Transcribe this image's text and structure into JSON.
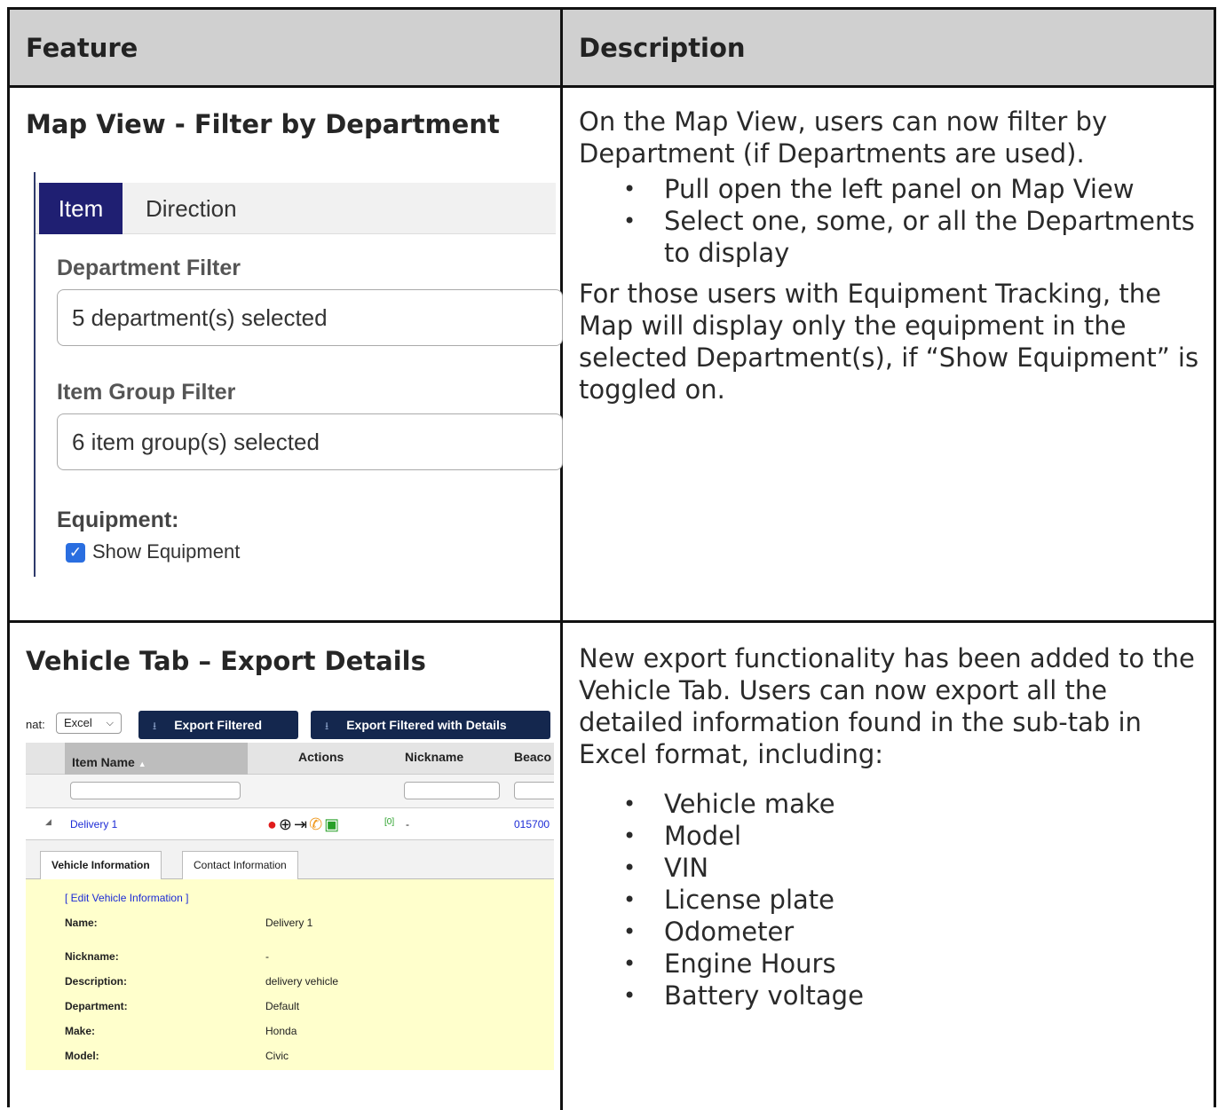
{
  "table": {
    "headers": {
      "feature": "Feature",
      "description": "Description"
    }
  },
  "row1": {
    "title": "Map View - Filter by Department",
    "para1": "On the Map View, users can now filter by Department (if Departments are used).",
    "bullets": [
      "Pull open the left panel on Map View",
      "Select one, some, or all the Departments to display"
    ],
    "para2": "For those users with Equipment Tracking, the Map will display only the equipment in the selected Department(s), if “Show Equipment” is toggled on.",
    "shot": {
      "tab_item": "Item",
      "tab_direction": "Direction",
      "dept_label": "Department Filter",
      "dept_value": "5 department(s) selected",
      "group_label": "Item Group Filter",
      "group_value": "6 item group(s) selected",
      "equipment_label": "Equipment:",
      "show_equipment": "Show Equipment"
    }
  },
  "row2": {
    "title": "Vehicle Tab – Export Details",
    "para1": "New export functionality has been added to the Vehicle Tab. Users can now export all the detailed information found in the sub-tab in Excel format, including:",
    "bullets": [
      "Vehicle make",
      "Model",
      "VIN",
      "License plate",
      "Odometer",
      "Engine Hours",
      "Battery voltage"
    ],
    "shot": {
      "format_label": "nat:",
      "format_value": "Excel",
      "btn_export": "Export Filtered",
      "btn_export_details": "Export Filtered with Details",
      "col_item": "Item Name",
      "col_actions": "Actions",
      "col_nickname": "Nickname",
      "col_beacon": "Beaco",
      "row_name": "Delivery 1",
      "row_count": "[0]",
      "row_nickname": "-",
      "row_beacon": "015700",
      "subtab1": "Vehicle Information",
      "subtab2": "Contact Information",
      "edit_link": "[ Edit Vehicle Information ]",
      "details": [
        {
          "k": "Name:",
          "v": "Delivery 1"
        },
        {
          "k": "Nickname:",
          "v": "-"
        },
        {
          "k": "Description:",
          "v": "delivery vehicle"
        },
        {
          "k": "Department:",
          "v": "Default"
        },
        {
          "k": "Make:",
          "v": "Honda"
        },
        {
          "k": "Model:",
          "v": "Civic"
        }
      ]
    }
  }
}
